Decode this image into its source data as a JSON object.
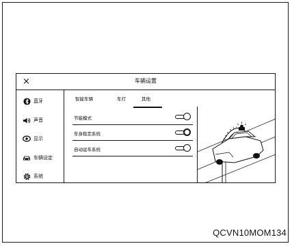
{
  "header": {
    "title": "车辆设置",
    "close_label": "×"
  },
  "sidebar": {
    "items": [
      {
        "label": "蓝牙",
        "icon": "bluetooth-icon"
      },
      {
        "label": "声音",
        "icon": "speaker-icon"
      },
      {
        "label": "显示",
        "icon": "display-icon"
      },
      {
        "label": "车辆设定",
        "icon": "car-icon"
      },
      {
        "label": "系统",
        "icon": "gear-icon"
      }
    ]
  },
  "tabs": [
    {
      "label": "智能车辆"
    },
    {
      "label": "车灯"
    },
    {
      "label": "其他",
      "selected": true
    }
  ],
  "settings": [
    {
      "label": "节能模式",
      "on": false
    },
    {
      "label": "车身稳定系统",
      "on": true
    },
    {
      "label": "自动驻车系统",
      "on": false
    }
  ],
  "illustration": {
    "caption": "illustration-of-car-stability-control"
  },
  "footer": {
    "code": "QCVN10MOM134"
  }
}
